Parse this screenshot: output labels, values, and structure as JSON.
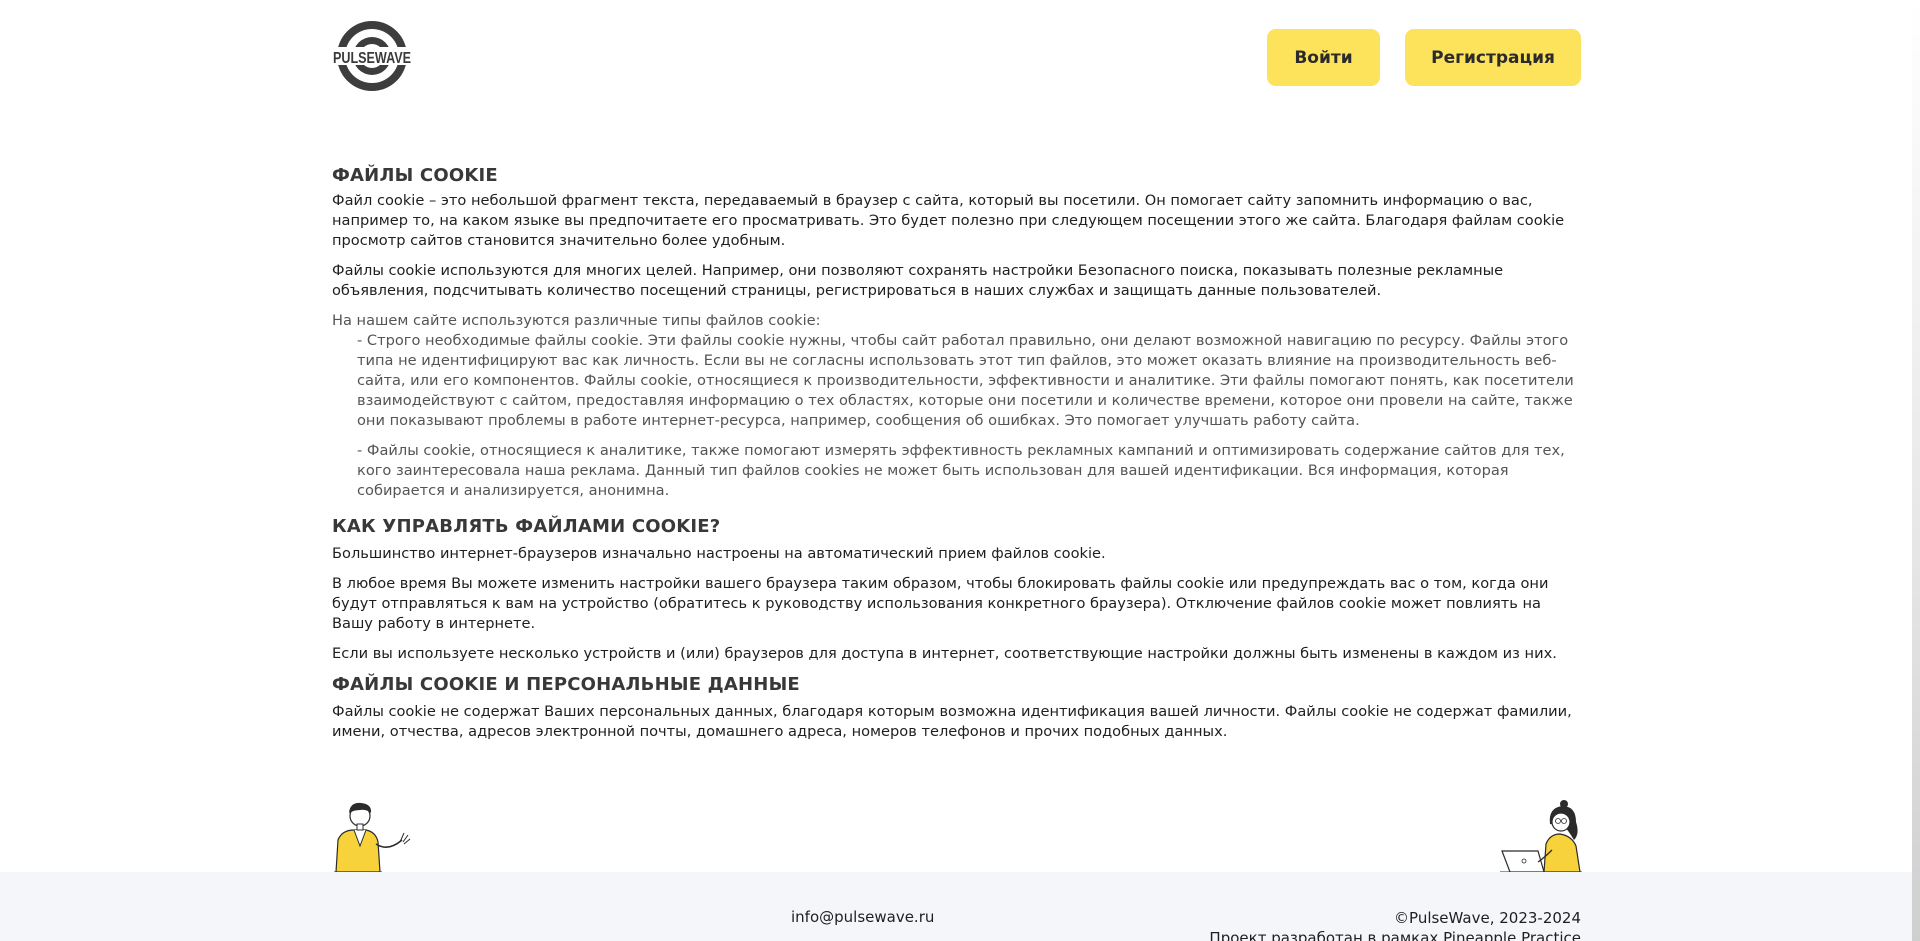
{
  "header": {
    "logo_text": "PULSEWAVE",
    "login_label": "Войти",
    "register_label": "Регистрация"
  },
  "content": {
    "section1": {
      "title": "ФАЙЛЫ COOKIE",
      "p1": "Файл cookie – это небольшой фрагмент текста, передаваемый в браузер с сайта, который вы посетили. Он помогает сайту запомнить информацию о вас, например то, на каком языке вы предпочитаете его просматривать. Это будет полезно при следующем посещении этого же сайта. Благодаря файлам cookie просмотр сайтов становится значительно более удобным.",
      "p2": "Файлы cookie используются для многих целей. Например, они позволяют сохранять настройки Безопасного поиска, показывать полезные рекламные объявления, подсчитывать количество посещений страницы, регистрироваться в наших службах и защищать данные пользователей.",
      "list_intro": "На нашем сайте используются различные типы файлов cookie:",
      "item1": "- Строго необходимые файлы cookie. Эти файлы cookie нужны, чтобы сайт работал правильно, они делают возможной навигацию по ресурсу. Файлы этого типа не идентифицируют вас как личность. Если вы не согласны использовать этот тип файлов, это может оказать влияние на производительность веб-сайта, или его компонентов. Файлы cookie, относящиеся к производительности, эффективности и аналитике. Эти файлы помогают понять, как посетители взаимодействуют с сайтом, предоставляя информацию о тех областях, которые они посетили и количестве времени, которое они провели на сайте, также они показывают проблемы в работе интернет-ресурса, например, сообщения об ошибках. Это помогает улучшать работу сайта.",
      "item2": "- Файлы cookie, относящиеся к аналитике, также помогают измерять эффективность рекламных кампаний и оптимизировать содержание сайтов для тех, кого заинтересовала наша реклама. Данный тип файлов cookies не может быть использован для вашей идентификации. Вся информация, которая собирается и анализируется, анонимна."
    },
    "section2": {
      "title": "КАК УПРАВЛЯТЬ ФАЙЛАМИ COOKIE?",
      "p1": "Большинство интернет-браузеров изначально настроены на автоматический прием файлов cookie.",
      "p2": "В любое время Вы можете изменить настройки вашего браузера таким образом, чтобы блокировать файлы cookie или предупреждать вас о том, когда они будут отправляться к вам на устройство (обратитесь к руководству использования конкретного браузера). Отключение файлов cookie может повлиять на Вашу работу в интернете.",
      "p3": "Если вы используете несколько устройств и (или) браузеров для доступа в интернет, соответствующие настройки должны быть изменены в каждом из них."
    },
    "section3": {
      "title": "ФАЙЛЫ COOKIE И ПЕРСОНАЛЬНЫЕ ДАННЫЕ",
      "p1": "Файлы cookie не содержат Ваших персональных данных, благодаря которым возможна идентификация вашей личности. Файлы cookie не содержат фамилии, имени, отчества, адресов электронной почты, домашнего адреса, номеров телефонов и прочих подобных данных."
    }
  },
  "footer": {
    "email": "info@pulsewave.ru",
    "copyright": "©PulseWave, 2023-2024",
    "project_note": "Проект разработан в рамках Pineapple Practice"
  },
  "colors": {
    "accent": "#fde25c",
    "footer_bg": "#f5f6fa",
    "logo": "#3a3a3a"
  },
  "icons": {
    "left_illustration": "man-waving-illustration",
    "right_illustration": "woman-with-laptop-illustration"
  }
}
